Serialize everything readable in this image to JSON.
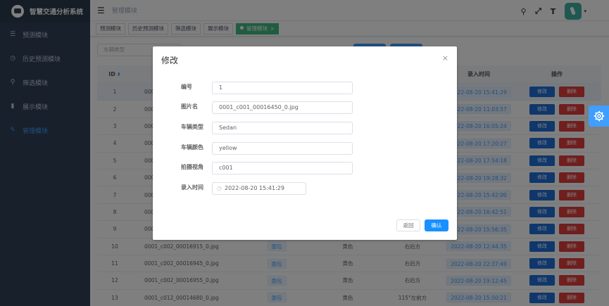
{
  "app": {
    "title": "智慧交通分析系统"
  },
  "sidebar": {
    "items": [
      {
        "label": "预测模块"
      },
      {
        "label": "历史预测模块"
      },
      {
        "label": "筛选模块"
      },
      {
        "label": "展示模块"
      },
      {
        "label": "管理模块"
      }
    ]
  },
  "navbar": {
    "breadcrumb": "管理模块"
  },
  "tags": [
    {
      "label": "预测模块"
    },
    {
      "label": "历史预测模块"
    },
    {
      "label": "筛选模块"
    },
    {
      "label": "展示模块"
    },
    {
      "label": "管理模块",
      "close": "×"
    }
  ],
  "filter": {
    "placeholder": "车辆类型"
  },
  "table": {
    "headers": {
      "id": "ID",
      "time": "录入时间",
      "op": "操作"
    },
    "edit_label": "修改",
    "delete_label": "删除",
    "rows": [
      {
        "id": "1",
        "img": "000",
        "type": "",
        "color": "",
        "view": "",
        "time": "2022-08-20 15:41:29"
      },
      {
        "id": "2",
        "img": "000",
        "type": "",
        "color": "",
        "view": "",
        "time": "2022-08-20 11:03:57"
      },
      {
        "id": "3",
        "img": "000",
        "type": "",
        "color": "",
        "view": "",
        "time": "2022-08-20 16:05:24"
      },
      {
        "id": "4",
        "img": "000",
        "type": "",
        "color": "",
        "view": "",
        "time": "2022-08-20 17:20:27"
      },
      {
        "id": "5",
        "img": "000",
        "type": "",
        "color": "",
        "view": "",
        "time": "2022-08-20 17:54:18"
      },
      {
        "id": "6",
        "img": "000",
        "type": "",
        "color": "",
        "view": "",
        "time": "2022-08-20 19:28:32"
      },
      {
        "id": "7",
        "img": "000",
        "type": "",
        "color": "",
        "view": "",
        "time": "2022-08-20 15:42:00"
      },
      {
        "id": "8",
        "img": "000",
        "type": "",
        "color": "",
        "view": "",
        "time": "2022-08-20 16:42:51"
      },
      {
        "id": "9",
        "img": "000",
        "type": "",
        "color": "",
        "view": "",
        "time": "2022-08-20 15:56:35"
      },
      {
        "id": "10",
        "img": "0001_c002_00016915_0.jpg",
        "type": "面包",
        "color": "黄色",
        "view": "右后方",
        "time": "2022-08-20 12:44:35"
      },
      {
        "id": "11",
        "img": "0001_c002_00016945_0.jpg",
        "type": "面包",
        "color": "黄色",
        "view": "右后方",
        "time": "2022-08-20 22:37:49"
      },
      {
        "id": "12",
        "img": "0001_c002_00016955_0.jpg",
        "type": "面包",
        "color": "黄色",
        "view": "右后方",
        "time": "2022-08-20 19:12:45"
      },
      {
        "id": "13",
        "img": "0001_c012_00014680_0.jpg",
        "type": "面包",
        "color": "黄色",
        "view": "115°左前方",
        "time": "2022-08-20 15:50:21"
      }
    ]
  },
  "dialog": {
    "title": "修改",
    "close": "×",
    "fields": [
      {
        "label": "编号",
        "value": "1"
      },
      {
        "label": "图片名",
        "value": "0001_c001_00016450_0.jpg"
      },
      {
        "label": "车辆类型",
        "value": "Sedan"
      },
      {
        "label": "车辆颜色",
        "value": "yellow"
      },
      {
        "label": "拍摄视角",
        "value": "c001"
      },
      {
        "label": "录入时间",
        "value": "2022-08-20 15:41:29"
      }
    ],
    "back_label": "返回",
    "ok_label": "确认"
  },
  "icons": {
    "menu": [
      "list-icon",
      "history-icon",
      "search-icon",
      "bar-chart-icon",
      "edit-icon"
    ],
    "navbar": [
      "search-icon",
      "fullscreen-icon",
      "font-size-icon",
      "avatar"
    ]
  },
  "colors": {
    "primary": "#409eff",
    "danger": "#e03c3c",
    "sidebar": "#304156",
    "tag_active": "#42b983"
  }
}
